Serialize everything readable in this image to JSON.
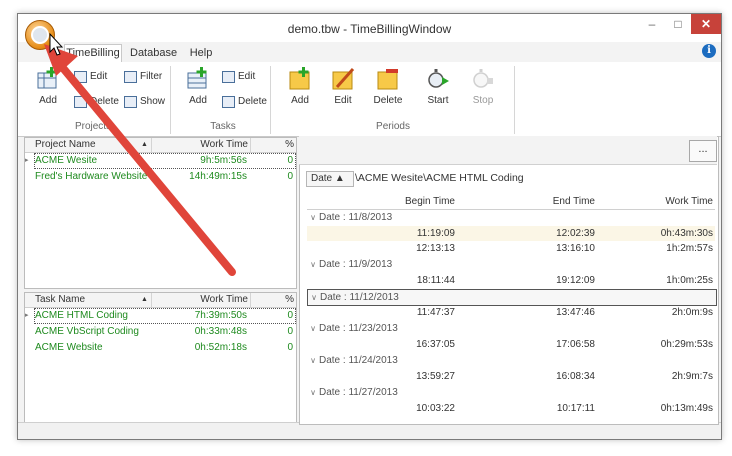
{
  "window": {
    "title": "demo.tbw - TimeBillingWindow",
    "min": "–",
    "max": "□",
    "close": "✕"
  },
  "menu_tabs": [
    "TimeBilling",
    "Database",
    "Help"
  ],
  "ribbon": {
    "projects": {
      "group": "Projects",
      "add": "Add",
      "edit": "Edit",
      "delete": "Delete",
      "filter": "Filter",
      "show": "Show"
    },
    "tasks": {
      "group": "Tasks",
      "add": "Add",
      "edit": "Edit",
      "delete": "Delete"
    },
    "periods": {
      "group": "Periods",
      "add": "Add",
      "edit": "Edit",
      "delete": "Delete",
      "start": "Start",
      "stop": "Stop"
    }
  },
  "projects_grid": {
    "headers": [
      "Project Name",
      "Work Time",
      "%"
    ],
    "rows": [
      {
        "name": "ACME Wesite",
        "time": "9h:5m:56s",
        "pct": "0"
      },
      {
        "name": "Fred's Hardware Website",
        "time": "14h:49m:15s",
        "pct": "0"
      }
    ]
  },
  "tasks_grid": {
    "headers": [
      "Task Name",
      "Work Time",
      "%"
    ],
    "rows": [
      {
        "name": "ACME HTML Coding",
        "time": "7h:39m:50s",
        "pct": "0"
      },
      {
        "name": "ACME VbScript Coding",
        "time": "0h:33m:48s",
        "pct": "0"
      },
      {
        "name": "ACME Website",
        "time": "0h:52m:18s",
        "pct": "0"
      }
    ]
  },
  "periods": {
    "more_button": "...",
    "group_chip": "Date ▲",
    "path": "\\ACME Wesite\\ACME HTML Coding",
    "headers": [
      "Begin Time",
      "End Time",
      "Work Time"
    ],
    "groups": [
      {
        "label": "Date : 11/8/2013",
        "rows": [
          [
            "11:19:09",
            "12:02:39",
            "0h:43m:30s"
          ],
          [
            "12:13:13",
            "13:16:10",
            "1h:2m:57s"
          ]
        ]
      },
      {
        "label": "Date : 11/9/2013",
        "rows": [
          [
            "18:11:44",
            "19:12:09",
            "1h:0m:25s"
          ]
        ]
      },
      {
        "label": "Date : 11/12/2013",
        "rows": [
          [
            "11:47:37",
            "13:47:46",
            "2h:0m:9s"
          ]
        ]
      },
      {
        "label": "Date : 11/23/2013",
        "rows": [
          [
            "16:37:05",
            "17:06:58",
            "0h:29m:53s"
          ]
        ]
      },
      {
        "label": "Date : 11/24/2013",
        "rows": [
          [
            "13:59:27",
            "16:08:34",
            "2h:9m:7s"
          ]
        ]
      },
      {
        "label": "Date : 11/27/2013",
        "rows": [
          [
            "10:03:22",
            "10:17:11",
            "0h:13m:49s"
          ]
        ]
      }
    ]
  },
  "colors": {
    "accent_green": "#1e8a1e",
    "close_red": "#c7423a",
    "arrow_red": "#e0453a"
  }
}
